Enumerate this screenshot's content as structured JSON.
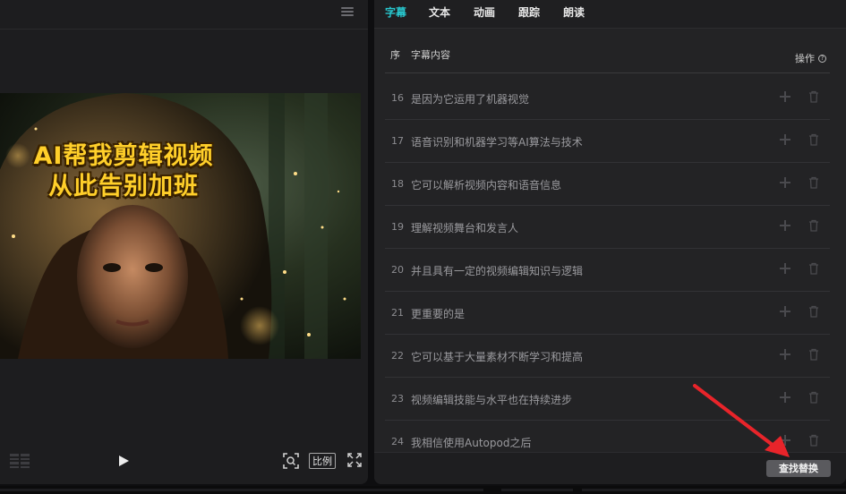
{
  "player": {
    "video_overlay": {
      "line1": "AI帮我剪辑视频",
      "line2": "从此告别加班"
    },
    "controls": {
      "ratio_label": "比例"
    }
  },
  "panel": {
    "tabs": [
      {
        "label": "字幕",
        "active": true
      },
      {
        "label": "文本",
        "active": false
      },
      {
        "label": "动画",
        "active": false
      },
      {
        "label": "跟踪",
        "active": false
      },
      {
        "label": "朗读",
        "active": false
      }
    ],
    "header": {
      "index_label": "序",
      "content_label": "字幕内容",
      "ops_label": "操作"
    },
    "rows": [
      {
        "index": "16",
        "text": "是因为它运用了机器视觉"
      },
      {
        "index": "17",
        "text": "语音识别和机器学习等AI算法与技术"
      },
      {
        "index": "18",
        "text": "它可以解析视频内容和语音信息"
      },
      {
        "index": "19",
        "text": "理解视频舞台和发言人"
      },
      {
        "index": "20",
        "text": "并且具有一定的视频编辑知识与逻辑"
      },
      {
        "index": "21",
        "text": "更重要的是"
      },
      {
        "index": "22",
        "text": "它可以基于大量素材不断学习和提高"
      },
      {
        "index": "23",
        "text": "视频编辑技能与水平也在持续进步"
      },
      {
        "index": "24",
        "text": "我相信使用Autopod之后"
      }
    ],
    "footer": {
      "find_replace_label": "查找替换"
    }
  },
  "colors": {
    "accent": "#28c8cf",
    "overlay_text": "#ffcf2a",
    "annotation_arrow": "#e8242a"
  }
}
